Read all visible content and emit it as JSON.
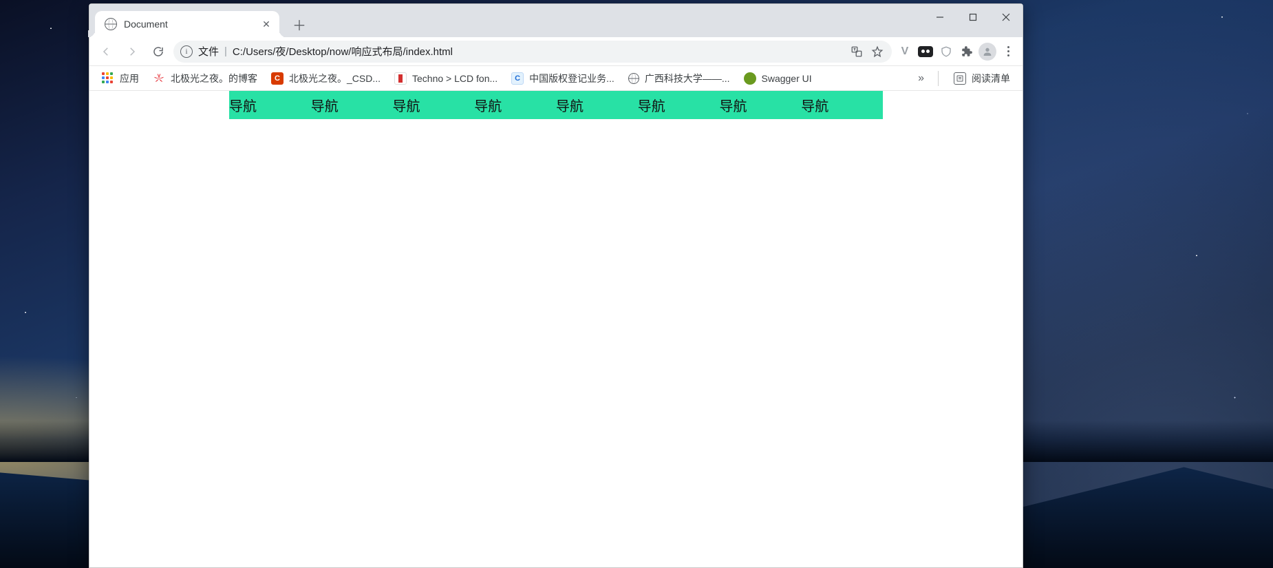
{
  "tab": {
    "title": "Document"
  },
  "window_controls": {
    "minimize": "minimize",
    "maximize": "maximize",
    "close": "close"
  },
  "omnibox": {
    "scheme_label": "文件",
    "path": "C:/Users/夜/Desktop/now/响应式布局/index.html"
  },
  "toolbar_icons": {
    "translate": "translate-icon",
    "star": "star-icon"
  },
  "extensions": [
    {
      "name": "vue-devtools",
      "letter": "V",
      "bg": "transparent",
      "fg": "#9aa0a6"
    },
    {
      "name": "ext-goggles",
      "letter": "",
      "bg": "#202124",
      "fg": "#fff"
    },
    {
      "name": "ext-shield",
      "letter": "",
      "bg": "transparent",
      "fg": "#9aa0a6"
    },
    {
      "name": "extensions-menu",
      "letter": "",
      "bg": "transparent",
      "fg": "#5f6368"
    }
  ],
  "bookmarks": [
    {
      "name": "apps",
      "label": "应用",
      "fav": "apps"
    },
    {
      "name": "huawei",
      "label": "北极光之夜。的博客",
      "fav_bg": "#e31b23",
      "fav_txt": ""
    },
    {
      "name": "csdn",
      "label": "北极光之夜。_CSD...",
      "fav_bg": "#d83b01",
      "fav_txt": "C"
    },
    {
      "name": "techno",
      "label": "Techno > LCD fon...",
      "fav_bg": "#d32f2f",
      "fav_txt": ""
    },
    {
      "name": "copyright",
      "label": "中国版权登记业务...",
      "fav_bg": "#e3f2fd",
      "fav_txt": "C",
      "fav_fg": "#1e6bd6"
    },
    {
      "name": "gxust",
      "label": "广西科技大学——...",
      "fav": "globe"
    },
    {
      "name": "swagger",
      "label": "Swagger UI",
      "fav_bg": "#6a9a1f",
      "fav_txt": ""
    }
  ],
  "bookmarks_overflow": "»",
  "reading_list_label": "阅读清单",
  "page": {
    "nav_items": [
      "导航",
      "导航",
      "导航",
      "导航",
      "导航",
      "导航",
      "导航",
      "导航"
    ],
    "nav_bg": "#28e1a5"
  }
}
